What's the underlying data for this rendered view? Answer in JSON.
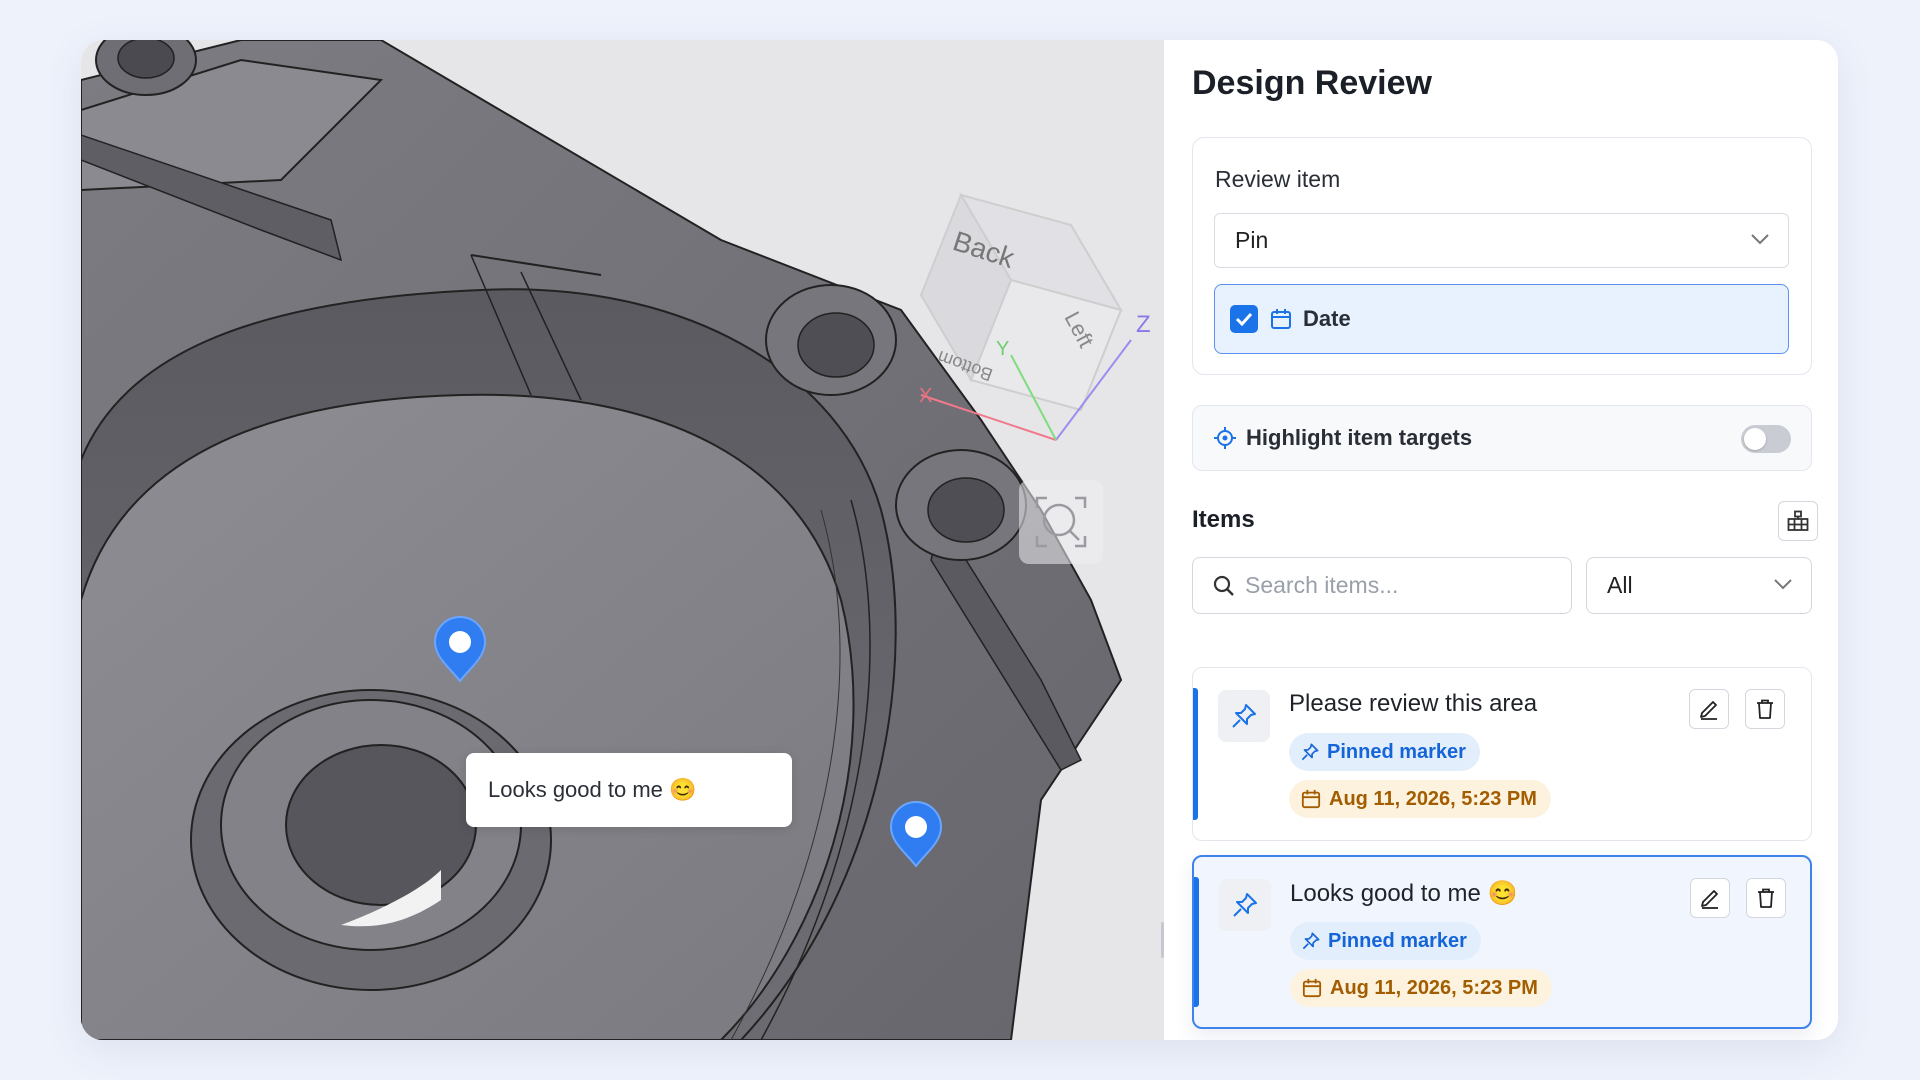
{
  "viewport": {
    "annotation_text": "Looks good to me 😊",
    "view_cube": {
      "back": "Back",
      "left": "Left",
      "bottom": "Bottom"
    },
    "axes": {
      "x": "X",
      "y": "Y",
      "z": "Z"
    }
  },
  "panel": {
    "title": "Design Review",
    "review_item": {
      "label": "Review item",
      "selected": "Pin",
      "date_option": "Date",
      "date_checked": true
    },
    "highlight": {
      "label": "Highlight item targets",
      "enabled": false
    },
    "items_section": {
      "title": "Items",
      "search_placeholder": "Search items...",
      "filter_selected": "All"
    },
    "items": [
      {
        "text": "Please review this area",
        "tag": "Pinned marker",
        "date": "Aug 11, 2026, 5:23 PM",
        "active": false
      },
      {
        "text": "Looks good to me 😊",
        "tag": "Pinned marker",
        "date": "Aug 11, 2026, 5:23 PM",
        "active": true
      }
    ]
  },
  "colors": {
    "accent": "#1a73e8",
    "marker": "#2f7df0",
    "chip_blue_text": "#1565d8",
    "chip_amber_text": "#a25d00"
  }
}
